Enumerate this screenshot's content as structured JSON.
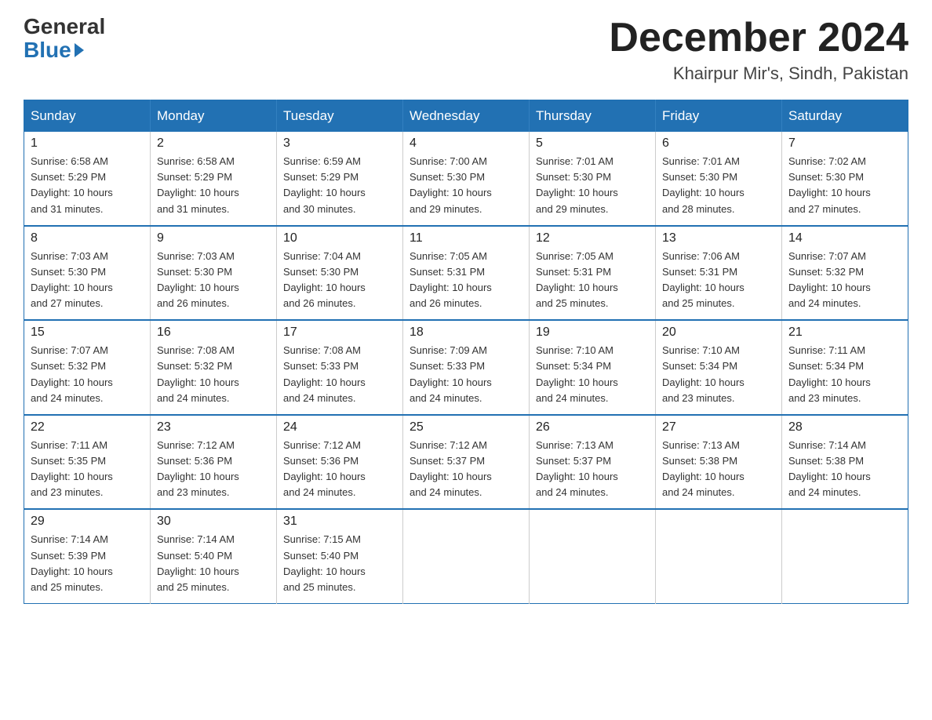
{
  "logo": {
    "general": "General",
    "blue": "Blue"
  },
  "title": {
    "month": "December 2024",
    "location": "Khairpur Mir's, Sindh, Pakistan"
  },
  "days_of_week": [
    "Sunday",
    "Monday",
    "Tuesday",
    "Wednesday",
    "Thursday",
    "Friday",
    "Saturday"
  ],
  "weeks": [
    [
      {
        "day": "1",
        "info": "Sunrise: 6:58 AM\nSunset: 5:29 PM\nDaylight: 10 hours\nand 31 minutes."
      },
      {
        "day": "2",
        "info": "Sunrise: 6:58 AM\nSunset: 5:29 PM\nDaylight: 10 hours\nand 31 minutes."
      },
      {
        "day": "3",
        "info": "Sunrise: 6:59 AM\nSunset: 5:29 PM\nDaylight: 10 hours\nand 30 minutes."
      },
      {
        "day": "4",
        "info": "Sunrise: 7:00 AM\nSunset: 5:30 PM\nDaylight: 10 hours\nand 29 minutes."
      },
      {
        "day": "5",
        "info": "Sunrise: 7:01 AM\nSunset: 5:30 PM\nDaylight: 10 hours\nand 29 minutes."
      },
      {
        "day": "6",
        "info": "Sunrise: 7:01 AM\nSunset: 5:30 PM\nDaylight: 10 hours\nand 28 minutes."
      },
      {
        "day": "7",
        "info": "Sunrise: 7:02 AM\nSunset: 5:30 PM\nDaylight: 10 hours\nand 27 minutes."
      }
    ],
    [
      {
        "day": "8",
        "info": "Sunrise: 7:03 AM\nSunset: 5:30 PM\nDaylight: 10 hours\nand 27 minutes."
      },
      {
        "day": "9",
        "info": "Sunrise: 7:03 AM\nSunset: 5:30 PM\nDaylight: 10 hours\nand 26 minutes."
      },
      {
        "day": "10",
        "info": "Sunrise: 7:04 AM\nSunset: 5:30 PM\nDaylight: 10 hours\nand 26 minutes."
      },
      {
        "day": "11",
        "info": "Sunrise: 7:05 AM\nSunset: 5:31 PM\nDaylight: 10 hours\nand 26 minutes."
      },
      {
        "day": "12",
        "info": "Sunrise: 7:05 AM\nSunset: 5:31 PM\nDaylight: 10 hours\nand 25 minutes."
      },
      {
        "day": "13",
        "info": "Sunrise: 7:06 AM\nSunset: 5:31 PM\nDaylight: 10 hours\nand 25 minutes."
      },
      {
        "day": "14",
        "info": "Sunrise: 7:07 AM\nSunset: 5:32 PM\nDaylight: 10 hours\nand 24 minutes."
      }
    ],
    [
      {
        "day": "15",
        "info": "Sunrise: 7:07 AM\nSunset: 5:32 PM\nDaylight: 10 hours\nand 24 minutes."
      },
      {
        "day": "16",
        "info": "Sunrise: 7:08 AM\nSunset: 5:32 PM\nDaylight: 10 hours\nand 24 minutes."
      },
      {
        "day": "17",
        "info": "Sunrise: 7:08 AM\nSunset: 5:33 PM\nDaylight: 10 hours\nand 24 minutes."
      },
      {
        "day": "18",
        "info": "Sunrise: 7:09 AM\nSunset: 5:33 PM\nDaylight: 10 hours\nand 24 minutes."
      },
      {
        "day": "19",
        "info": "Sunrise: 7:10 AM\nSunset: 5:34 PM\nDaylight: 10 hours\nand 24 minutes."
      },
      {
        "day": "20",
        "info": "Sunrise: 7:10 AM\nSunset: 5:34 PM\nDaylight: 10 hours\nand 23 minutes."
      },
      {
        "day": "21",
        "info": "Sunrise: 7:11 AM\nSunset: 5:34 PM\nDaylight: 10 hours\nand 23 minutes."
      }
    ],
    [
      {
        "day": "22",
        "info": "Sunrise: 7:11 AM\nSunset: 5:35 PM\nDaylight: 10 hours\nand 23 minutes."
      },
      {
        "day": "23",
        "info": "Sunrise: 7:12 AM\nSunset: 5:36 PM\nDaylight: 10 hours\nand 23 minutes."
      },
      {
        "day": "24",
        "info": "Sunrise: 7:12 AM\nSunset: 5:36 PM\nDaylight: 10 hours\nand 24 minutes."
      },
      {
        "day": "25",
        "info": "Sunrise: 7:12 AM\nSunset: 5:37 PM\nDaylight: 10 hours\nand 24 minutes."
      },
      {
        "day": "26",
        "info": "Sunrise: 7:13 AM\nSunset: 5:37 PM\nDaylight: 10 hours\nand 24 minutes."
      },
      {
        "day": "27",
        "info": "Sunrise: 7:13 AM\nSunset: 5:38 PM\nDaylight: 10 hours\nand 24 minutes."
      },
      {
        "day": "28",
        "info": "Sunrise: 7:14 AM\nSunset: 5:38 PM\nDaylight: 10 hours\nand 24 minutes."
      }
    ],
    [
      {
        "day": "29",
        "info": "Sunrise: 7:14 AM\nSunset: 5:39 PM\nDaylight: 10 hours\nand 25 minutes."
      },
      {
        "day": "30",
        "info": "Sunrise: 7:14 AM\nSunset: 5:40 PM\nDaylight: 10 hours\nand 25 minutes."
      },
      {
        "day": "31",
        "info": "Sunrise: 7:15 AM\nSunset: 5:40 PM\nDaylight: 10 hours\nand 25 minutes."
      },
      null,
      null,
      null,
      null
    ]
  ]
}
